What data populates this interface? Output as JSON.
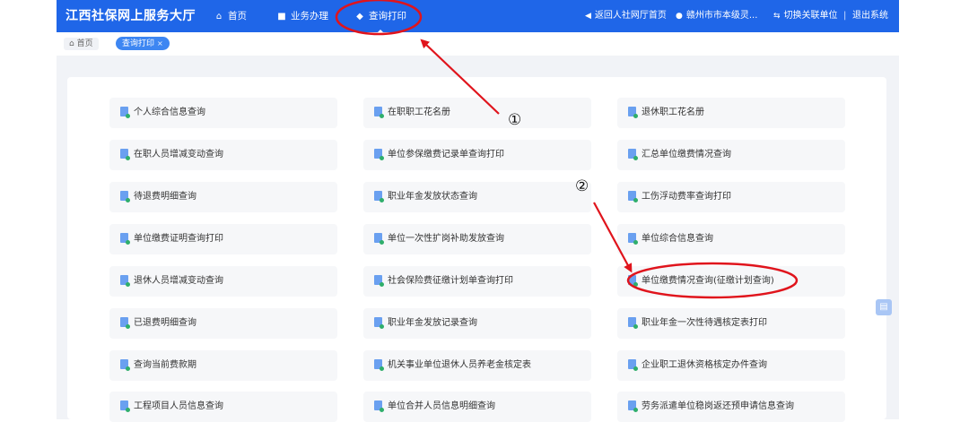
{
  "header": {
    "brand": "江西社保网上服务大厅",
    "nav": [
      {
        "icon": "home-icon",
        "label": "首页"
      },
      {
        "icon": "briefcase-icon",
        "label": "业务办理"
      },
      {
        "icon": "print-icon",
        "label": "查询打印"
      }
    ],
    "right": [
      {
        "icon": "back-icon",
        "label": "返回人社网厅首页"
      },
      {
        "icon": "user-icon",
        "label": "赣州市市本级灵..."
      },
      {
        "icon": "switch-icon",
        "label": "切换关联单位"
      },
      {
        "label": "退出系统"
      }
    ],
    "separator": "|"
  },
  "breadcrumb": {
    "home": "首页",
    "active_tab": "查询打印",
    "close": "×"
  },
  "menu": {
    "items": [
      "个人综合信息查询",
      "在职职工花名册",
      "退休职工花名册",
      "在职人员增减变动查询",
      "单位参保缴费记录单查询打印",
      "汇总单位缴费情况查询",
      "待退费明细查询",
      "职业年金发放状态查询",
      "工伤浮动费率查询打印",
      "单位缴费证明查询打印",
      "单位一次性扩岗补助发放查询",
      "单位综合信息查询",
      "退休人员增减变动查询",
      "社会保险费征缴计划单查询打印",
      "单位缴费情况查询(征缴计划查询)",
      "已退费明细查询",
      "职业年金发放记录查询",
      "职业年金一次性待遇核定表打印",
      "查询当前费款期",
      "机关事业单位退休人员养老金核定表",
      "企业职工退休资格核定办件查询",
      "工程项目人员信息查询",
      "单位合并人员信息明细查询",
      "劳务派遣单位稳岗返还预申请信息查询"
    ]
  },
  "annotations": {
    "callout1": "①",
    "callout2": "②",
    "color": "#e0141c"
  },
  "colors": {
    "primary": "#1f66e8",
    "content_bg": "#f1f3f7",
    "item_bg": "#f6f7f9"
  }
}
